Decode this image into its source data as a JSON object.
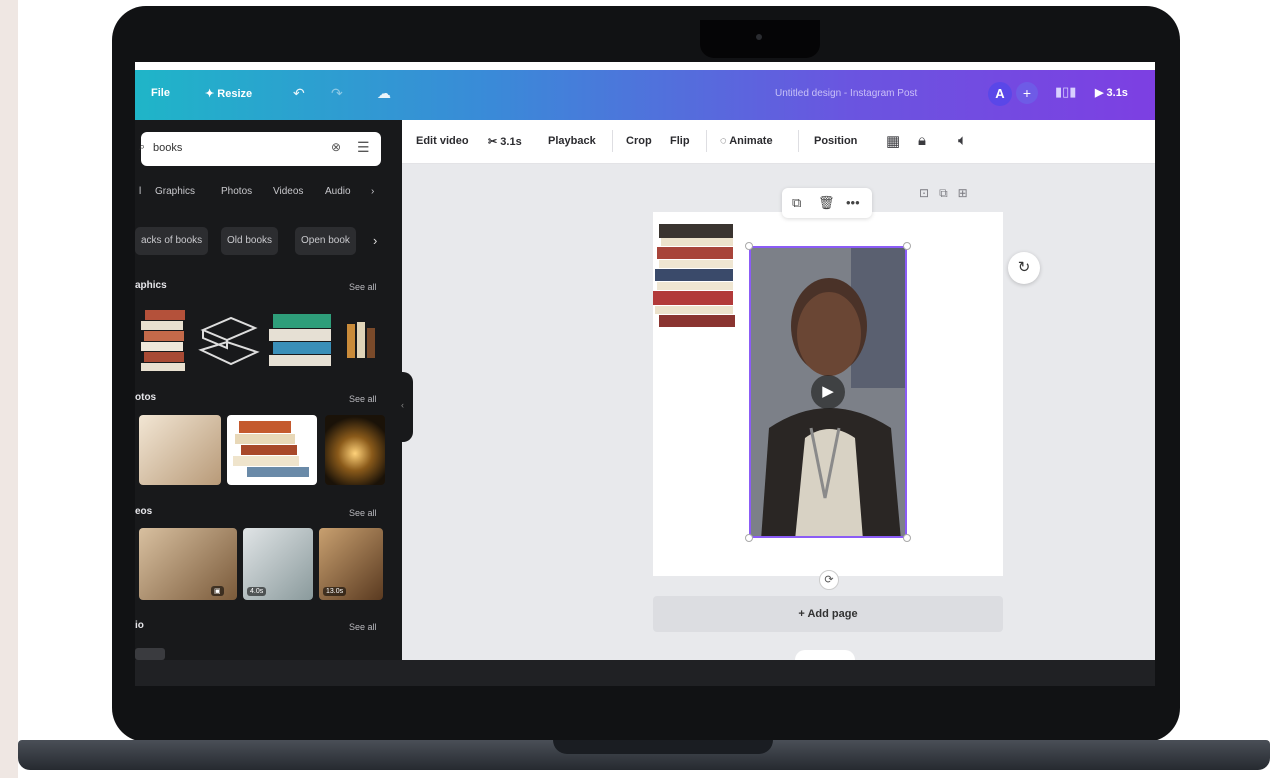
{
  "topbar": {
    "file_label": "File",
    "resize_label": "Resize",
    "design_title": "Untitled design - Instagram Post",
    "avatar_letter": "A",
    "share_time": "3.1s"
  },
  "panel": {
    "search_value": "books",
    "tabs": [
      "Graphics",
      "Photos",
      "Videos",
      "Audio"
    ],
    "chips": [
      "acks of books",
      "Old books",
      "Open book"
    ],
    "sections": {
      "graphics": "aphics",
      "photos": "otos",
      "videos": "eos",
      "audio": "io"
    },
    "see_all": "See all",
    "video_badges": [
      "",
      "4.0s",
      "13.0s"
    ]
  },
  "toolbar": {
    "edit_video": "Edit video",
    "duration": "3.1s",
    "playback": "Playback",
    "crop": "Crop",
    "flip": "Flip",
    "animate": "Animate",
    "position": "Position"
  },
  "canvas": {
    "add_page": "+ Add page"
  }
}
